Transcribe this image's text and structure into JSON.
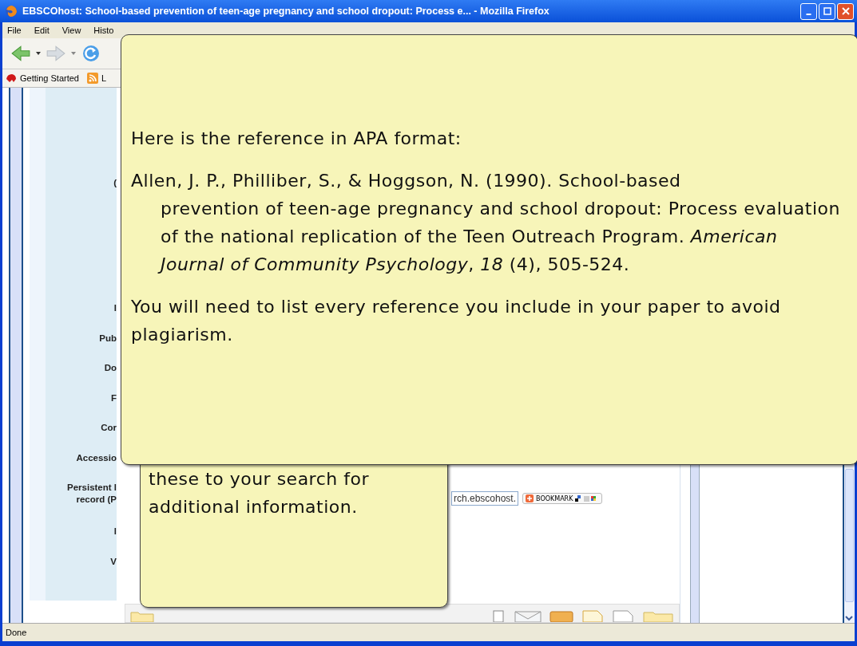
{
  "window": {
    "title": "EBSCOhost: School-based prevention of teen-age pregnancy and school dropout: Process e... - Mozilla Firefox"
  },
  "menu": [
    "File",
    "Edit",
    "View",
    "Histo"
  ],
  "bookmarks": [
    "Getting Started",
    "L"
  ],
  "record_labels": [
    {
      "lines": [
        "("
      ]
    },
    {
      "lines": [
        "I"
      ]
    },
    {
      "lines": [
        "Pub"
      ]
    },
    {
      "lines": [
        "Do"
      ]
    },
    {
      "lines": [
        "F"
      ]
    },
    {
      "lines": [
        "Cor"
      ]
    },
    {
      "lines": [
        "Accessio"
      ]
    },
    {
      "lines": [
        "Persistent l",
        "record (P"
      ]
    },
    {
      "lines": [
        "l"
      ]
    },
    {
      "lines": [
        "V"
      ]
    }
  ],
  "permalink_field": {
    "value": "rch.ebscohost."
  },
  "bookmark_button": {
    "label": "BOOKMARK"
  },
  "status_bar": {
    "text": "Done"
  },
  "callouts": [
    {
      "intro": "Here is the reference in APA format:",
      "reference_lines": [
        "Allen, J. P., Philliber, S., & Hoggson, N. (1990). School-based",
        "prevention of teen-age pregnancy and school dropout: Process evaluation",
        "of the national replication of the Teen Outreach Program. *American*",
        "*Journal of Community Psychology*, *18* (4), 505-524."
      ],
      "note": "You will need to list every reference you include in your paper to avoid plagiarism."
    },
    {
      "note": "these to your search for additional information."
    }
  ]
}
